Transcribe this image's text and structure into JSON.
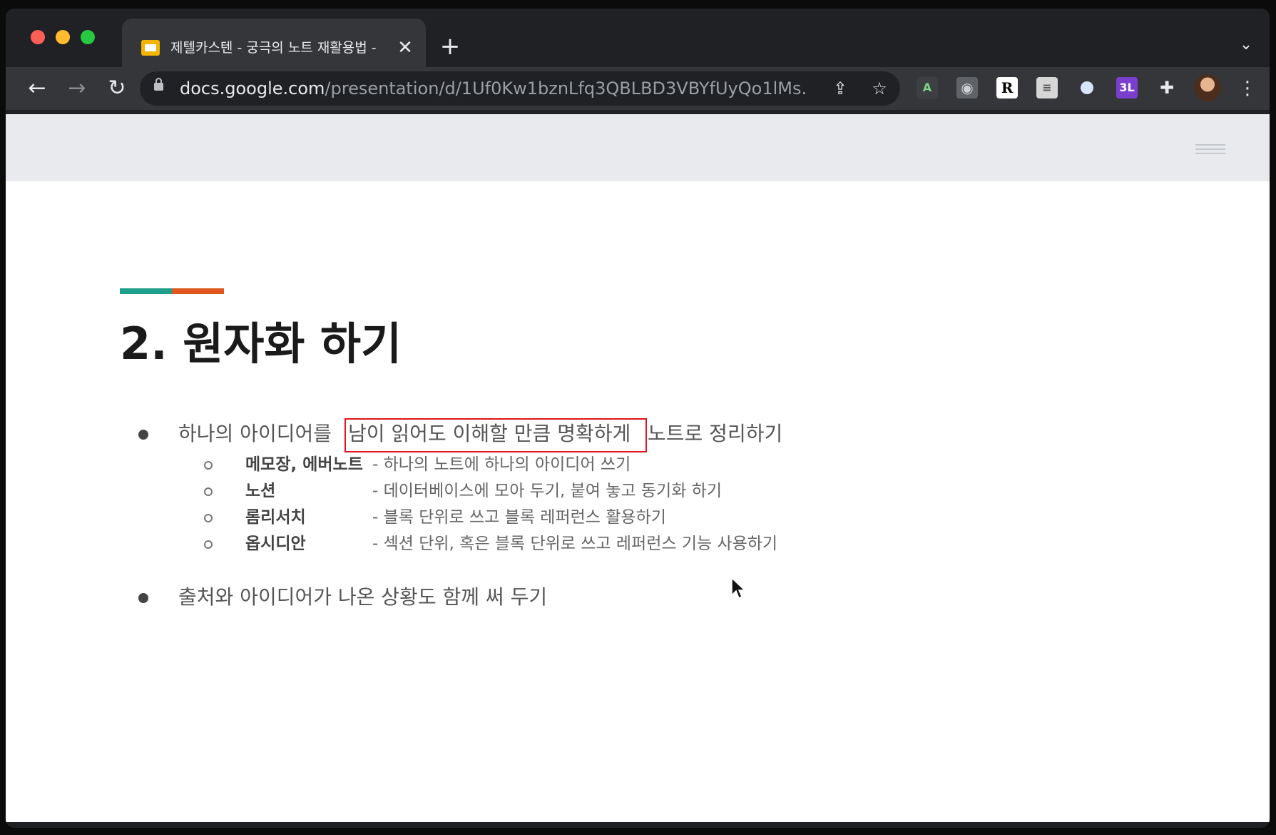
{
  "browser": {
    "tab_title": "제텔카스텐 - 궁극의 노트 재활용법 -",
    "tab_close": "✕",
    "new_tab": "+",
    "tab_list": "⌄",
    "url_host": "docs.google.com",
    "url_path": "/presentation/d/1Uf0Kw1bznLfq3QBLBD3VBYfUyQo1lMs...",
    "nav": {
      "back": "←",
      "forward": "→",
      "reload": "↻"
    },
    "icons": {
      "share": "⇪",
      "star": "☆",
      "menu": "⋮",
      "puzzle": "✚",
      "ext_r": "R",
      "ext_3l": "3L",
      "ext_a": "A",
      "ext_doc": "≡"
    }
  },
  "slide": {
    "title": "2. 원자화 하기",
    "bullets": [
      {
        "text_before": "하나의 아이디어를 ",
        "highlight": "남이 읽어도 이해할 만큼 명확하게",
        "text_after": " 노트로 정리하기",
        "sub_items": [
          {
            "name": "메모장, 에버노트",
            "desc": "- 하나의 노트에 하나의 아이디어 쓰기"
          },
          {
            "name": "노션",
            "desc": "- 데이터베이스에 모아 두기, 붙여 놓고 동기화 하기"
          },
          {
            "name": "롬리서치",
            "desc": "- 블록 단위로 쓰고 블록 레퍼런스 활용하기"
          },
          {
            "name": "옵시디안",
            "desc": "- 섹션 단위, 혹은 블록 단위로 쓰고 레퍼런스 기능 사용하기"
          }
        ]
      },
      {
        "text": "출처와 아이디어가 나온 상황도 함께 써 두기"
      }
    ],
    "accent_colors": {
      "teal": "#1f9e8c",
      "orange": "#e0561f",
      "highlight_border": "#e0141e"
    }
  }
}
